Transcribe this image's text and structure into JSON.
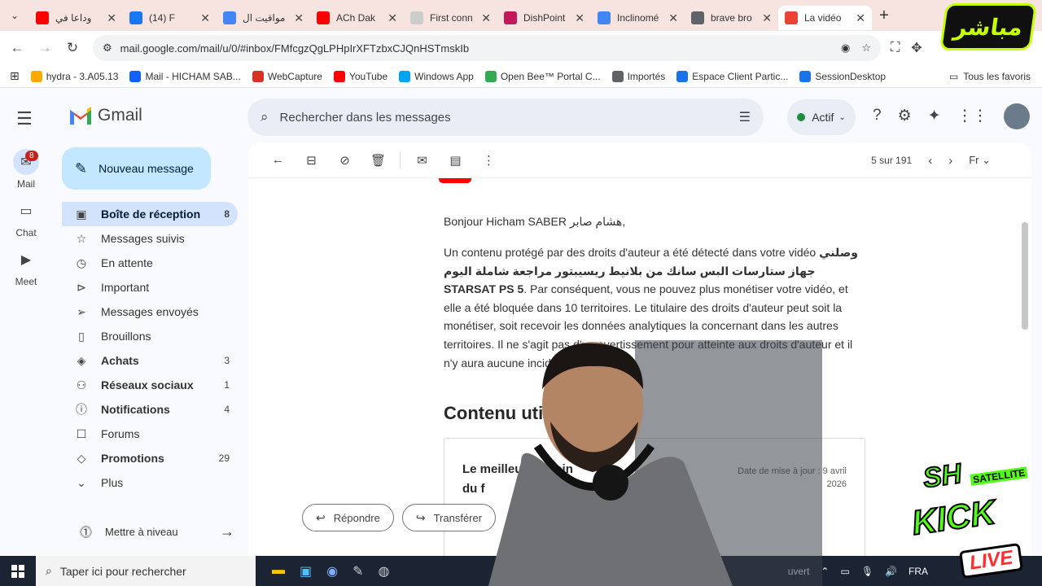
{
  "browser": {
    "tabs": [
      {
        "label": "وداعا في",
        "color": "#ff0000",
        "active": false
      },
      {
        "label": "(14) F",
        "color": "#1877f2",
        "active": false
      },
      {
        "label": "مواقيت ال",
        "color": "#4285f4",
        "active": false
      },
      {
        "label": "ACh Dak",
        "color": "#ff0000",
        "active": false
      },
      {
        "label": "First conn",
        "color": "#cccccc",
        "active": false
      },
      {
        "label": "DishPoint",
        "color": "#c2185b",
        "active": false
      },
      {
        "label": "Inclinomé",
        "color": "#4285f4",
        "active": false
      },
      {
        "label": "brave bro",
        "color": "#5f6368",
        "active": false
      },
      {
        "label": "La vidéo",
        "color": "#ea4335",
        "active": true
      }
    ],
    "url": "mail.google.com/mail/u/0/#inbox/FMfcgzQgLPHpIrXFTzbxCJQnHSTmskIb",
    "bookmarks": [
      {
        "label": "hydra - 3.A05.13",
        "color": "#f9ab00"
      },
      {
        "label": "Mail - HICHAM SAB...",
        "color": "#0f62fe"
      },
      {
        "label": "WebCapture",
        "color": "#d93025"
      },
      {
        "label": "YouTube",
        "color": "#ff0000"
      },
      {
        "label": "Windows App",
        "color": "#00a4ef"
      },
      {
        "label": "Open Bee™ Portal C...",
        "color": "#34a853"
      },
      {
        "label": "Importés",
        "color": "#5f6368"
      },
      {
        "label": "Espace Client Partic...",
        "color": "#1a73e8"
      },
      {
        "label": "SessionDesktop",
        "color": "#1a73e8"
      }
    ],
    "all_bookmarks": "Tous les favoris"
  },
  "gmail": {
    "brand": "Gmail",
    "search_placeholder": "Rechercher dans les messages",
    "status": "Actif",
    "rail": [
      {
        "label": "Mail",
        "badge": "8"
      },
      {
        "label": "Chat"
      },
      {
        "label": "Meet"
      }
    ],
    "compose": "Nouveau message",
    "labels": [
      {
        "name": "Boîte de réception",
        "count": "8",
        "icon": "inbox-icon",
        "glyph": "▣",
        "active": true,
        "bold": true
      },
      {
        "name": "Messages suivis",
        "count": "",
        "icon": "star-icon",
        "glyph": "☆",
        "active": false,
        "bold": false
      },
      {
        "name": "En attente",
        "count": "",
        "icon": "clock-icon",
        "glyph": "◷",
        "active": false,
        "bold": false
      },
      {
        "name": "Important",
        "count": "",
        "icon": "important-icon",
        "glyph": "⊳",
        "active": false,
        "bold": false
      },
      {
        "name": "Messages envoyés",
        "count": "",
        "icon": "send-icon",
        "glyph": "➢",
        "active": false,
        "bold": false
      },
      {
        "name": "Brouillons",
        "count": "",
        "icon": "draft-icon",
        "glyph": "▯",
        "active": false,
        "bold": false
      },
      {
        "name": "Achats",
        "count": "3",
        "icon": "shopping-bag-icon",
        "glyph": "◈",
        "active": false,
        "bold": true
      },
      {
        "name": "Réseaux sociaux",
        "count": "1",
        "icon": "people-icon",
        "glyph": "⚇",
        "active": false,
        "bold": true
      },
      {
        "name": "Notifications",
        "count": "4",
        "icon": "info-icon",
        "glyph": "ⓘ",
        "active": false,
        "bold": true
      },
      {
        "name": "Forums",
        "count": "",
        "icon": "forum-icon",
        "glyph": "☐",
        "active": false,
        "bold": false
      },
      {
        "name": "Promotions",
        "count": "29",
        "icon": "tag-icon",
        "glyph": "◇",
        "active": false,
        "bold": true
      },
      {
        "name": "Plus",
        "count": "",
        "icon": "chevron-down-icon",
        "glyph": "⌄",
        "active": false,
        "bold": false
      }
    ],
    "upgrade": "Mettre à niveau",
    "pager": "5 sur 191",
    "message": {
      "greeting": "Bonjour Hicham SABER هشام صابر,",
      "body_1": "Un contenu protégé par des droits d'auteur a été détecté dans votre vidéo",
      "video_title": "وصلني جهاز ستارسات البس سانك من بلانيط ريسيبتور مراجعة شاملة اليوم STARSAT PS 5",
      "body_2": ". Par conséquent, vous ne pouvez plus monétiser votre vidéo, et elle a été bloquée dans 10 territoires. Le titulaire des droits d'auteur peut soit la monétiser, soit recevoir les données analytiques la concernant dans les autres territoires. Il ne s'agit pas d'un avertissement pour atteinte aux droits d'auteur et il n'y aura aucune incidence su",
      "section_title": "Contenu uti",
      "card_title": "Le meilleur pâ coin du f",
      "card_date": "Date de mise à jour : 9 avril 2026"
    },
    "reply": "Répondre",
    "forward": "Transférer"
  },
  "taskbar": {
    "search_placeholder": "Taper ici pour rechercher",
    "lang": "FRA",
    "tray_text": "uvert"
  },
  "overlays": {
    "top_badge": "مباشر",
    "sh": "SH",
    "satellite": "SATELLITE",
    "kick": "KICK",
    "live": "LIVE"
  }
}
